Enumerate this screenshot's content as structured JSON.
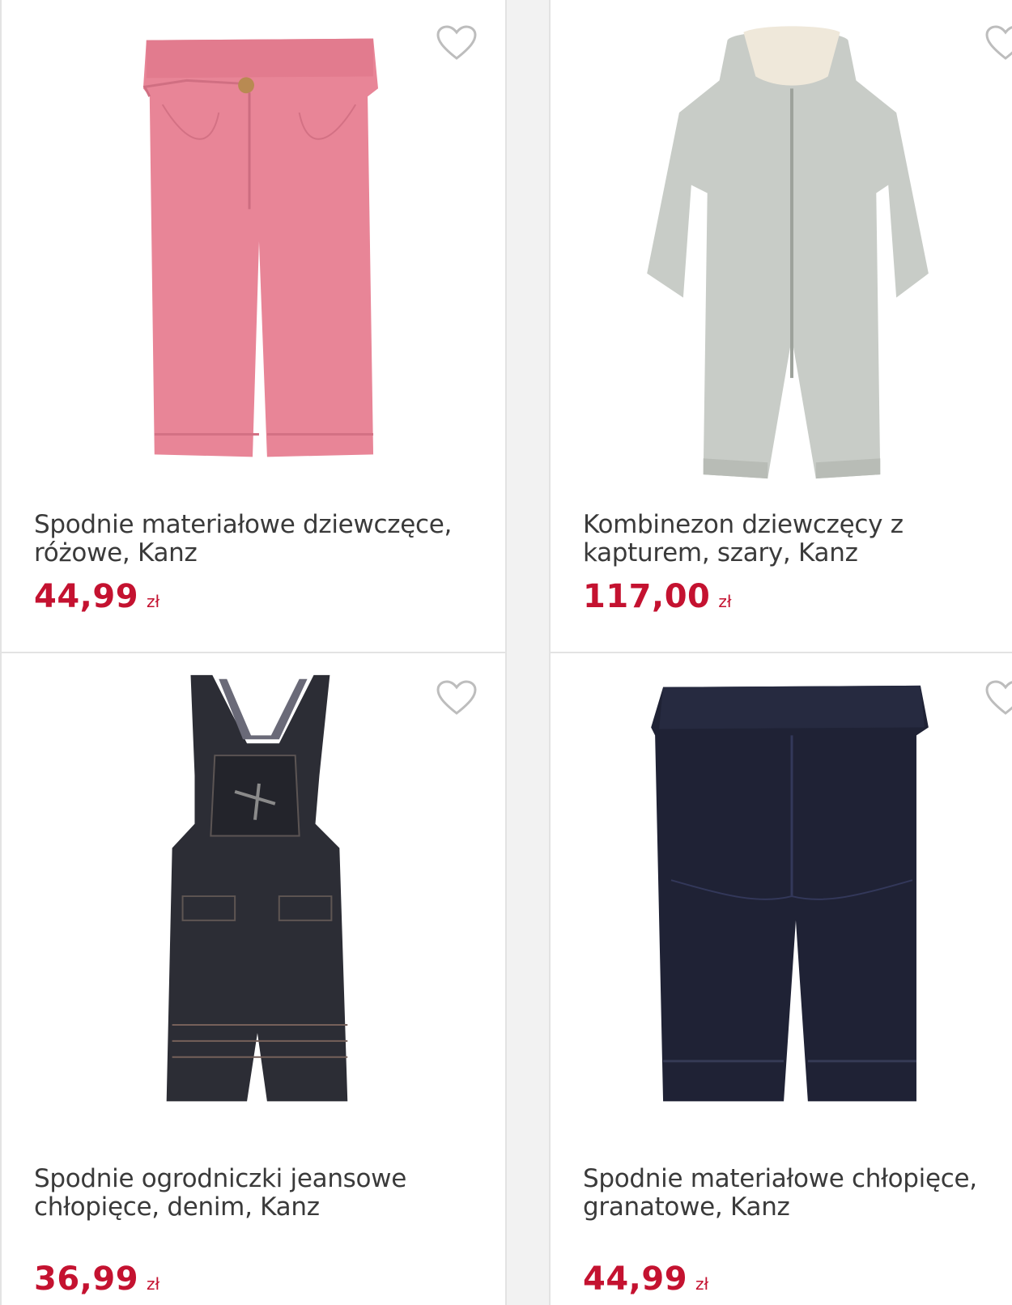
{
  "products": [
    {
      "title": "Spodnie materiałowe dziewczęce, różowe, Kanz",
      "price": "44,99",
      "currency": "zł",
      "image_icon": "pink-corduroy-pants-image"
    },
    {
      "title": "Kombinezon dziewczęcy z kapturem, szary, Kanz",
      "price": "117,00",
      "currency": "zł",
      "image_icon": "grey-hooded-jumpsuit-image"
    },
    {
      "title": "Spodnie ogrodniczki jeansowe chłopięce, denim, Kanz",
      "price": "36,99",
      "currency": "zł",
      "image_icon": "denim-dungarees-image"
    },
    {
      "title": "Spodnie materiałowe chłopięce, granatowe, Kanz",
      "price": "44,99",
      "currency": "zł",
      "image_icon": "navy-pants-image"
    }
  ],
  "colors": {
    "price": "#c41230",
    "title": "#3a3a3a",
    "card_border": "#e3e3e3",
    "background": "#f2f2f2"
  }
}
